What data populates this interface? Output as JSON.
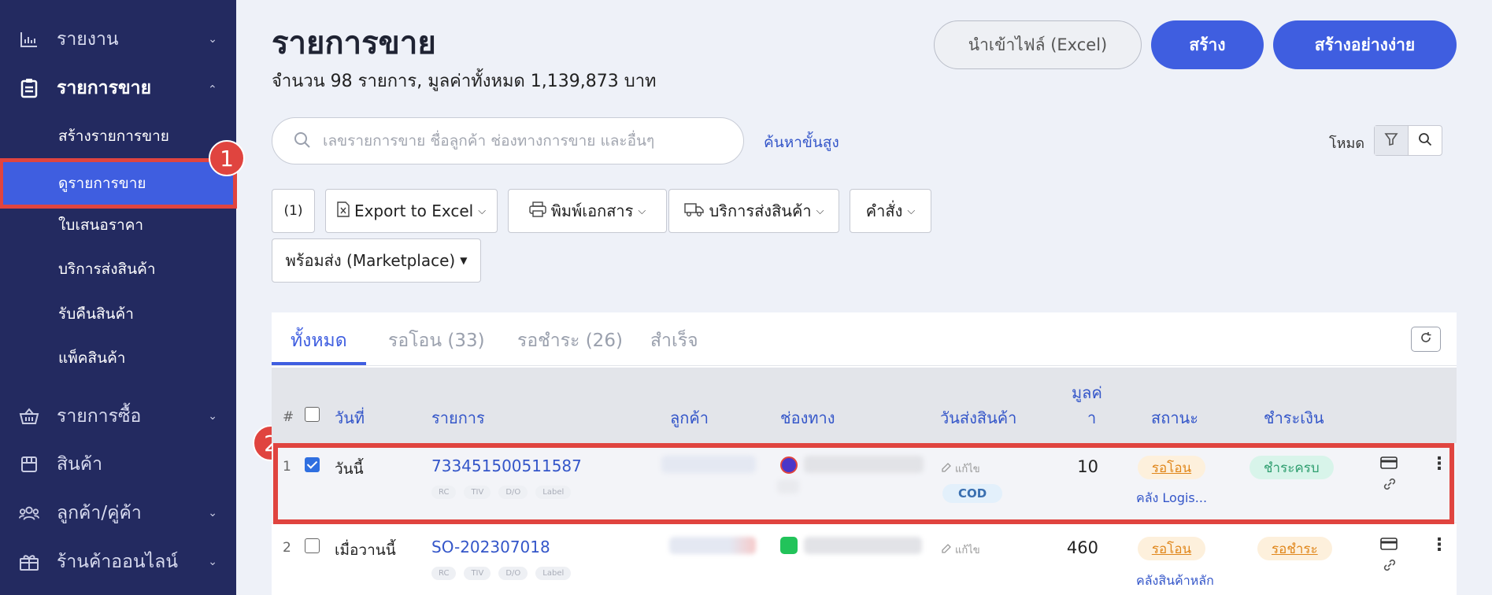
{
  "sidebar": {
    "items": [
      {
        "label": "รายงาน",
        "icon": "bar-chart-icon"
      },
      {
        "label": "รายการขาย",
        "icon": "clipboard-icon"
      },
      {
        "label": "รายการซื้อ",
        "icon": "basket-icon"
      },
      {
        "label": "สินค้า",
        "icon": "box-icon"
      },
      {
        "label": "ลูกค้า/คู่ค้า",
        "icon": "people-icon"
      },
      {
        "label": "ร้านค้าออนไลน์",
        "icon": "gift-icon"
      }
    ],
    "sub_items": [
      "สร้างรายการขาย",
      "ดูรายการขาย",
      "ใบเสนอราคา",
      "บริการส่งสินค้า",
      "รับคืนสินค้า",
      "แพ็คสินค้า"
    ],
    "markers": [
      "1",
      "2"
    ]
  },
  "header": {
    "title": "รายการขาย",
    "subtitle": "จำนวน 98 รายการ, มูลค่าทั้งหมด 1,139,873 บาท",
    "import_label": "นำเข้าไฟล์ (Excel)",
    "create_label": "สร้าง",
    "create_easy_label": "สร้างอย่างง่าย"
  },
  "search": {
    "placeholder": "เลขรายการขาย ชื่อลูกค้า ช่องทางการขาย และอื่นๆ",
    "advanced_label": "ค้นหาขั้นสูง",
    "mode_label": "โหมด"
  },
  "toolbar": {
    "count_label": "(1)",
    "export_label": "Export to Excel",
    "print_label": "พิมพ์เอกสาร",
    "shipping_label": "บริการส่งสินค้า",
    "command_label": "คำสั่ง",
    "ready_label": "พร้อมส่ง (Marketplace)"
  },
  "tabs": [
    "ทั้งหมด",
    "รอโอน (33)",
    "รอชำระ (26)",
    "สำเร็จ"
  ],
  "table": {
    "headers": {
      "hash": "#",
      "date": "วันที่",
      "order": "รายการ",
      "customer": "ลูกค้า",
      "channel": "ช่องทาง",
      "ship_date": "วันส่งสินค้า",
      "value_1": "มูลค่",
      "value_2": "า",
      "status": "สถานะ",
      "payment": "ชำระเงิน"
    },
    "tags": [
      "RC",
      "TIV",
      "D/O",
      "Label"
    ],
    "edit_label": "แก้ไข",
    "rows": [
      {
        "num": "1",
        "date": "วันนี้",
        "order": "733451500511587",
        "cod": "COD",
        "value": "10",
        "status": "รอโอน",
        "warehouse": "คลัง Logis...",
        "payment": "ชำระครบ",
        "checked": true
      },
      {
        "num": "2",
        "date": "เมื่อวานนี้",
        "order": "SO-202307018",
        "cod": "",
        "value": "460",
        "status": "รอโอน",
        "warehouse": "คลังสินค้าหลัก",
        "payment": "รอชำระ",
        "checked": false
      }
    ]
  },
  "colors": {
    "sidebar": "#232a60",
    "primary": "#3f5ee0",
    "highlight": "#e0443f"
  }
}
